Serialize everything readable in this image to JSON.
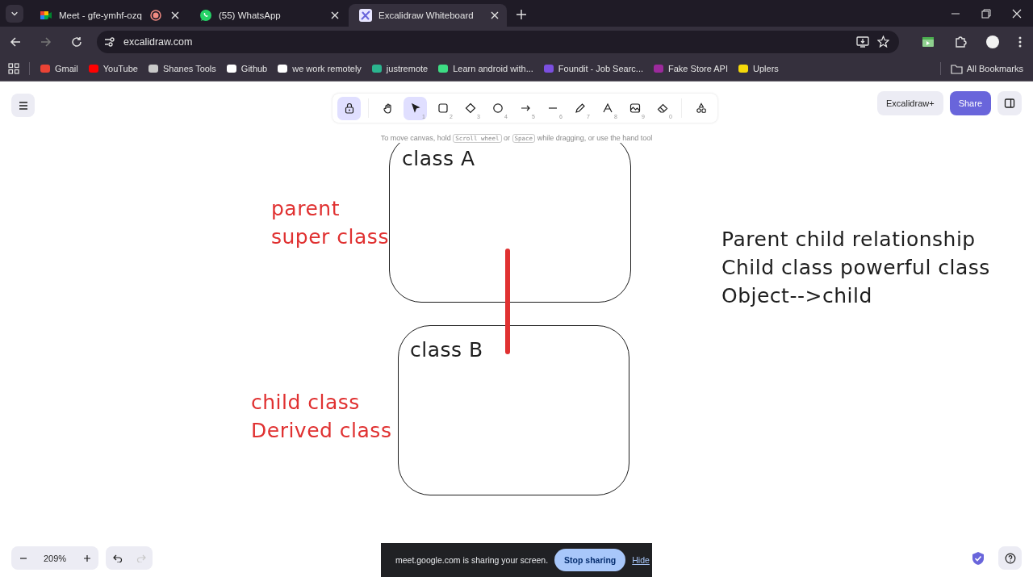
{
  "browser": {
    "tabs": [
      {
        "title": "Meet - gfe-ymhf-ozq",
        "kind": "meet",
        "recording": true,
        "selected": false
      },
      {
        "title": "(55) WhatsApp",
        "kind": "whatsapp",
        "recording": false,
        "selected": false
      },
      {
        "title": "Excalidraw Whiteboard",
        "kind": "excalidraw",
        "recording": false,
        "selected": true
      }
    ],
    "address": "excalidraw.com",
    "bookmarks": [
      {
        "label": "Gmail",
        "kind": "gmail"
      },
      {
        "label": "YouTube",
        "kind": "youtube"
      },
      {
        "label": "Shanes Tools",
        "kind": "globe"
      },
      {
        "label": "Github",
        "kind": "github"
      },
      {
        "label": "we work remotely",
        "kind": "wwr"
      },
      {
        "label": "justremote",
        "kind": "justremote"
      },
      {
        "label": "Learn android with...",
        "kind": "android"
      },
      {
        "label": "Foundit - Job Searc...",
        "kind": "foundit"
      },
      {
        "label": "Fake Store API",
        "kind": "fakestore"
      },
      {
        "label": "Uplers",
        "kind": "uplers"
      }
    ],
    "all_bookmarks": "All Bookmarks"
  },
  "toolbar": {
    "lock": {
      "on": true
    },
    "tools": [
      {
        "kind": "hand",
        "selected": false
      },
      {
        "kind": "selection",
        "key": "1",
        "selected": true
      },
      {
        "kind": "rectangle",
        "key": "2",
        "selected": false
      },
      {
        "kind": "diamond",
        "key": "3",
        "selected": false
      },
      {
        "kind": "ellipse",
        "key": "4",
        "selected": false
      },
      {
        "kind": "arrow",
        "key": "5",
        "selected": false
      },
      {
        "kind": "line",
        "key": "6",
        "selected": false
      },
      {
        "kind": "draw",
        "key": "7",
        "selected": false
      },
      {
        "kind": "text",
        "key": "8",
        "selected": false
      },
      {
        "kind": "image",
        "key": "9",
        "selected": false
      },
      {
        "kind": "eraser",
        "key": "0",
        "selected": false
      }
    ]
  },
  "hint": [
    {
      "kind": "text",
      "text": "To move canvas, hold"
    },
    {
      "kind": "key",
      "text": "Scroll wheel"
    },
    {
      "kind": "text",
      "text": "or"
    },
    {
      "kind": "key",
      "text": "Space"
    },
    {
      "kind": "text",
      "text": "while dragging, or use the hand tool"
    }
  ],
  "canvas": {
    "shapes": [
      {
        "kind": "rectangle",
        "color": "#1e1e1e"
      },
      {
        "kind": "rectangle",
        "color": "#1e1e1e"
      },
      {
        "kind": "line",
        "color": "#e03131"
      }
    ],
    "texts": [
      {
        "lines": [
          "class A"
        ],
        "color": "#1e1e1e"
      },
      {
        "lines": [
          "class B"
        ],
        "color": "#1e1e1e"
      },
      {
        "lines": [
          "parent",
          "super class"
        ],
        "color": "#e03131"
      },
      {
        "lines": [
          "child class",
          "Derived class"
        ],
        "color": "#e03131"
      },
      {
        "lines": [
          "Parent child relationship",
          "Child class powerful class",
          "Object-->child"
        ],
        "color": "#1e1e1e"
      }
    ]
  },
  "top_right": {
    "plus": "Excalidraw+",
    "share": "Share"
  },
  "zoom": "209%",
  "undo": {
    "disabled": false
  },
  "redo": {
    "disabled": true
  },
  "sharing_banner": {
    "message": "meet.google.com is sharing your screen.",
    "stop": "Stop sharing",
    "hide": "Hide"
  }
}
